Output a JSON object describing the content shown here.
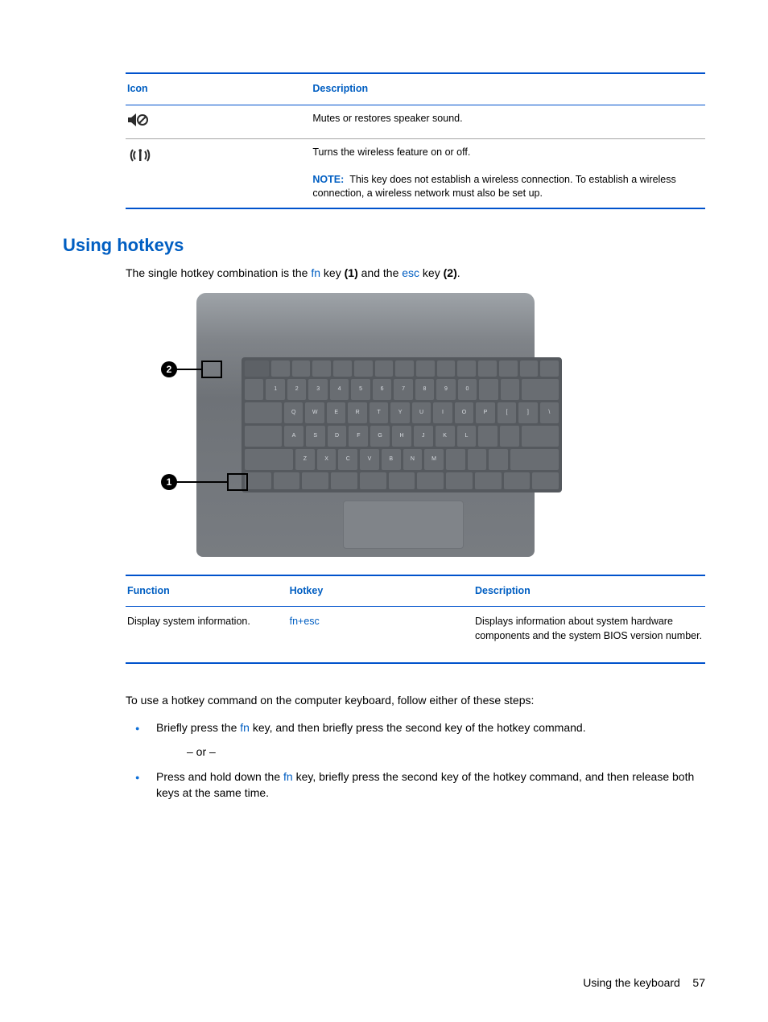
{
  "iconTable": {
    "headers": {
      "icon": "Icon",
      "description": "Description"
    },
    "rows": [
      {
        "iconName": "mute-icon",
        "description": "Mutes or restores speaker sound."
      },
      {
        "iconName": "wireless-icon",
        "description": "Turns the wireless feature on or off.",
        "noteLabel": "NOTE:",
        "noteText": "This key does not establish a wireless connection. To establish a wireless connection, a wireless network must also be set up."
      }
    ]
  },
  "sectionTitle": "Using hotkeys",
  "introText": {
    "prefix": "The single hotkey combination is the ",
    "fn": "fn",
    "mid1": " key ",
    "b1": "(1)",
    "mid2": " and the ",
    "esc": "esc",
    "mid3": " key ",
    "b2": "(2)",
    "suffix": "."
  },
  "callouts": {
    "one": "1",
    "two": "2"
  },
  "hotkeyTable": {
    "headers": {
      "function": "Function",
      "hotkey": "Hotkey",
      "description": "Description"
    },
    "row": {
      "function": "Display system information.",
      "hotkey": "fn+esc",
      "description": "Displays information about system hardware components and the system BIOS version number."
    }
  },
  "instructions": {
    "lead": "To use a hotkey command on the computer keyboard, follow either of these steps:",
    "item1": {
      "prefix": "Briefly press the ",
      "fn": "fn",
      "suffix": " key, and then briefly press the second key of the hotkey command."
    },
    "or": "– or –",
    "item2": {
      "prefix": "Press and hold down the ",
      "fn": "fn",
      "suffix": " key, briefly press the second key of the hotkey command, and then release both keys at the same time."
    }
  },
  "footer": {
    "section": "Using the keyboard",
    "page": "57"
  }
}
